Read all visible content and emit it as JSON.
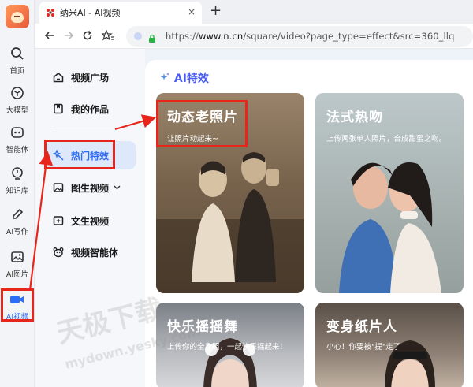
{
  "app_sidebar": {
    "items": [
      {
        "label": "首页",
        "icon": "search-icon"
      },
      {
        "label": "大模型",
        "icon": "cube-icon"
      },
      {
        "label": "智能体",
        "icon": "agent-icon"
      },
      {
        "label": "知识库",
        "icon": "lightbulb-icon"
      },
      {
        "label": "AI写作",
        "icon": "pen-icon"
      },
      {
        "label": "AI图片",
        "icon": "image-icon"
      },
      {
        "label": "AI视频",
        "icon": "video-camera-icon"
      }
    ],
    "active_index": 6
  },
  "browser": {
    "tab_title": "纳米AI - AI视频",
    "tab_close": "×",
    "new_tab": "+",
    "url_prefix": "https://",
    "url_host": "www.n.cn",
    "url_path": "/square/video?page_type=effect&src=360_llq"
  },
  "nav": {
    "items": [
      {
        "label": "视频广场",
        "icon": "home-icon"
      },
      {
        "label": "我的作品",
        "icon": "bookmark-icon"
      },
      {
        "label": "热门特效",
        "icon": "magic-wand-icon"
      },
      {
        "label": "图生视频",
        "icon": "picture-icon"
      },
      {
        "label": "文生视频",
        "icon": "text-video-icon"
      },
      {
        "label": "视频智能体",
        "icon": "bear-icon"
      }
    ],
    "active_index": 2,
    "expand_icon": "chevron-down-icon"
  },
  "main": {
    "section_title": "AI特效",
    "cards": [
      {
        "title": "动态老照片",
        "subtitle": "让照片动起来~"
      },
      {
        "title": "法式热吻",
        "subtitle": "上传两张单人照片，合成甜蜜之吻。"
      },
      {
        "title": "快乐摇摇舞",
        "subtitle": "上传你的全身照，一起快乐摇起来！"
      },
      {
        "title": "变身纸片人",
        "subtitle": "小心！你要被\"提\"走了"
      }
    ]
  },
  "watermark": {
    "text1": "天极下载",
    "text2": "mydown.yesky.com"
  },
  "colors": {
    "accent": "#2d6cf6",
    "highlight": "#e8251b",
    "section_title": "#4a5cf0"
  }
}
